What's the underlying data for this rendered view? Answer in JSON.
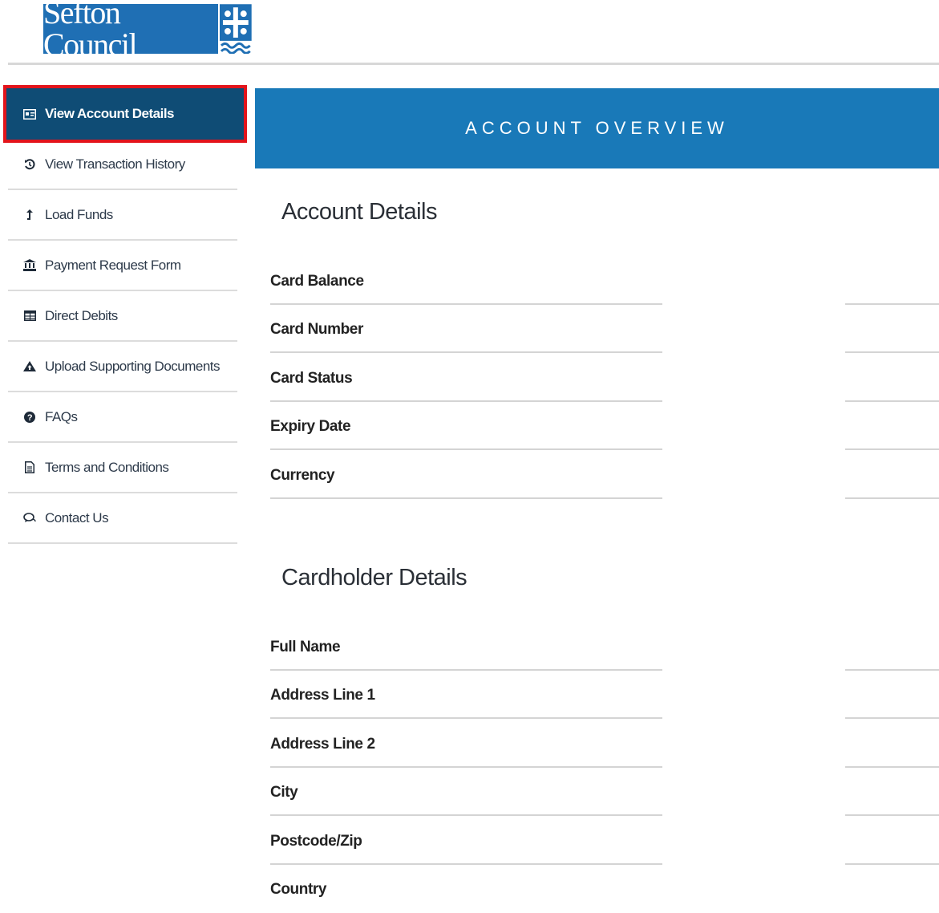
{
  "header": {
    "logo_text": "Sefton Council",
    "brand_color": "#1f6fb4"
  },
  "sidebar": {
    "items": [
      {
        "label": "View Account Details",
        "icon": "id-card-icon",
        "active": true
      },
      {
        "label": "View Transaction History",
        "icon": "history-icon"
      },
      {
        "label": "Load Funds",
        "icon": "upload-arrow-icon"
      },
      {
        "label": "Payment Request Form",
        "icon": "bank-icon"
      },
      {
        "label": "Direct Debits",
        "icon": "table-icon"
      },
      {
        "label": "Upload Supporting Documents",
        "icon": "cloud-upload-icon"
      },
      {
        "label": "FAQs",
        "icon": "question-circle-icon"
      },
      {
        "label": "Terms and Conditions",
        "icon": "document-icon"
      },
      {
        "label": "Contact Us",
        "icon": "chat-icon"
      }
    ],
    "active_color": "#0f4c75",
    "highlight_color": "#e3141b"
  },
  "main": {
    "banner_title": "ACCOUNT OVERVIEW",
    "banner_color": "#1979b8",
    "account_section": {
      "title": "Account Details",
      "fields": [
        "Card Balance",
        "Card Number",
        "Card Status",
        "Expiry Date",
        "Currency"
      ]
    },
    "cardholder_section": {
      "title": "Cardholder Details",
      "fields": [
        "Full Name",
        "Address Line 1",
        "Address Line 2",
        "City",
        "Postcode/Zip",
        "Country"
      ]
    }
  }
}
